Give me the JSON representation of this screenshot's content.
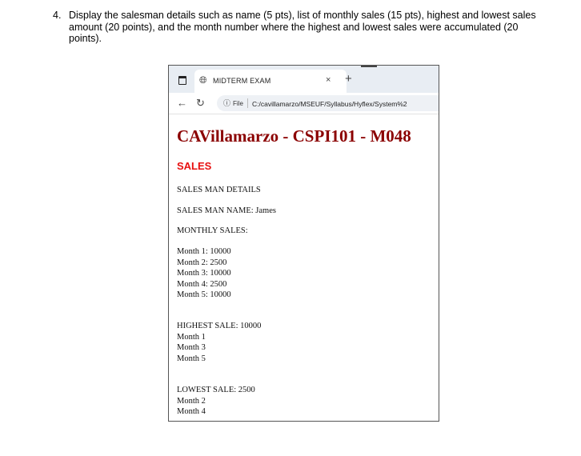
{
  "question": {
    "number": "4.",
    "text": "Display the salesman details such as name (5 pts), list of monthly sales (15 pts), highest and lowest sales amount (20 points), and the month number where the highest and lowest sales were accumulated (20 points)."
  },
  "browser": {
    "tab_title": "MIDTERM EXAM",
    "close_glyph": "×",
    "new_tab_glyph": "+",
    "url_scheme": "File",
    "url": "C:/cavillamarzo/MSEUF/Syllabus/Hyflex/System%2",
    "icons": [
      "window-icon",
      "globe-icon",
      "close-icon",
      "plus-icon",
      "back-arrow-icon",
      "reload-icon",
      "info-icon"
    ]
  },
  "page": {
    "heading": "CAVillamarzo - CSPI101 - M048",
    "subheading": "SALES",
    "details_label": "SALES MAN DETAILS",
    "name_line": "SALES MAN NAME: James",
    "monthly_label": "MONTHLY SALES:",
    "monthly": [
      "Month 1: 10000",
      "Month 2: 2500",
      "Month 3: 10000",
      "Month 4: 2500",
      "Month 5: 10000"
    ],
    "highest_line": "HIGHEST SALE: 10000",
    "highest_months": [
      "Month 1",
      "Month 3",
      "Month 5"
    ],
    "lowest_line": "LOWEST SALE: 2500",
    "lowest_months": [
      "Month 2",
      "Month 4"
    ]
  },
  "colors": {
    "heading": "#8b0000",
    "subheading": "#e81010",
    "tabbar": "#e8edf3"
  }
}
